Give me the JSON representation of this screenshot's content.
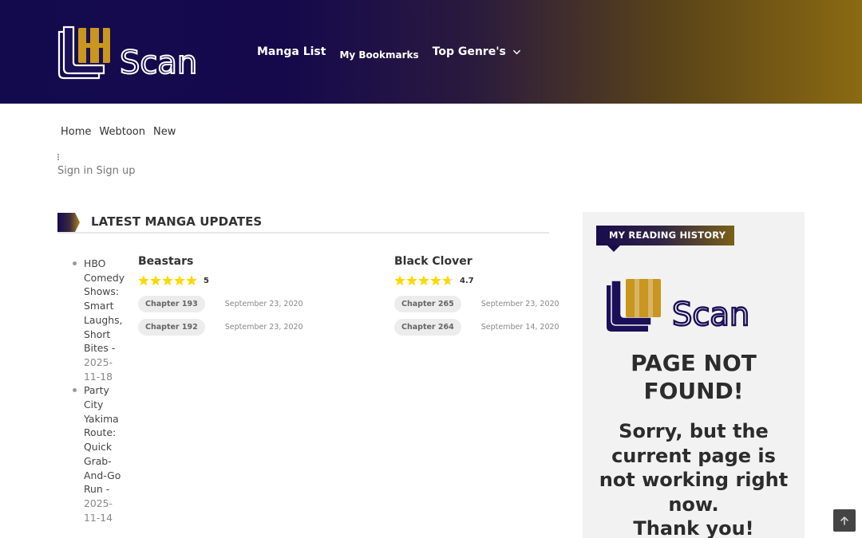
{
  "brand": {
    "logo_text": "Scan",
    "colors": {
      "navy": "#130a4e",
      "gold": "#c9961e",
      "white": "#ffffff"
    }
  },
  "nav": {
    "items": [
      {
        "label": "Manga List"
      },
      {
        "label": "My Bookmarks"
      },
      {
        "label": "Top Genre's",
        "icon": "chevron-down-icon"
      }
    ]
  },
  "breadcrumb": {
    "items": [
      {
        "label": "Home"
      },
      {
        "label": "Webtoon"
      },
      {
        "label": "New"
      }
    ]
  },
  "auth": {
    "sign_in": "Sign in",
    "sign_up": "Sign up"
  },
  "latest": {
    "heading": "LATEST MANGA UPDATES",
    "news": [
      {
        "title": "HBO Comedy Shows: Smart Laughs, Short Bites",
        "date": "2025-11-18"
      },
      {
        "title": "Party City Yakima Route: Quick Grab-And-Go Run",
        "date": "2025-11-14"
      }
    ],
    "manga": [
      {
        "name": "Beastars",
        "rating": "5",
        "rating_value": 5,
        "chapters": [
          {
            "label": "Chapter 193",
            "date": "September 23, 2020"
          },
          {
            "label": "Chapter 192",
            "date": "September 23, 2020"
          }
        ]
      },
      {
        "name": "Black Clover",
        "rating": "4.7",
        "rating_value": 4.7,
        "chapters": [
          {
            "label": "Chapter 265",
            "date": "September 23, 2020"
          },
          {
            "label": "Chapter 264",
            "date": "September 14, 2020"
          }
        ]
      }
    ]
  },
  "sidebar": {
    "history_label": "MY READING HISTORY",
    "not_found_title": "PAGE NOT FOUND!",
    "not_found_message": "Sorry, but the current page is not working right now.",
    "thank_you": "Thank you!"
  },
  "icons": {
    "back_to_top": "arrow-up-icon",
    "more": "dots-vertical-icon"
  },
  "star_color": "#ffd800"
}
